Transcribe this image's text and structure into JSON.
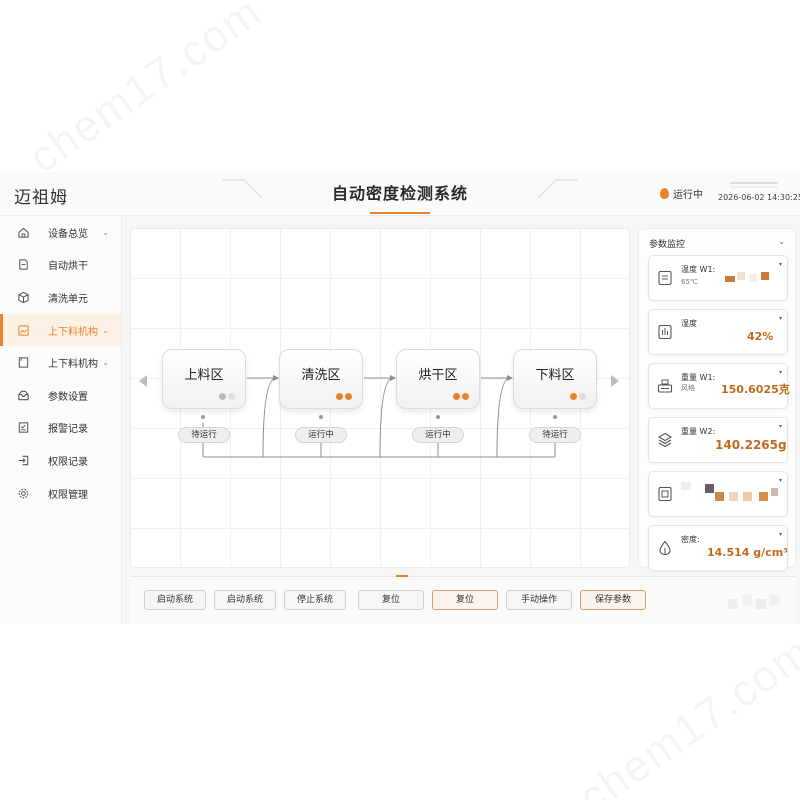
{
  "header": {
    "brand": "迈祖姆",
    "title": "自动密度检测系统",
    "status": "运行中",
    "datetime": "2026-06-02  14:30:25"
  },
  "sidebar": {
    "items": [
      {
        "label": "设备总览",
        "icon": "home-icon",
        "chevron": true,
        "active": false
      },
      {
        "label": "自动烘干",
        "icon": "document-icon",
        "chevron": false,
        "active": false
      },
      {
        "label": "清洗单元",
        "icon": "cube-icon",
        "chevron": false,
        "active": false
      },
      {
        "label": "上下料机构",
        "icon": "image-icon",
        "chevron": true,
        "active": true
      },
      {
        "label": "上下料机构",
        "icon": "document-icon",
        "chevron": true,
        "active": false
      },
      {
        "label": "参数设置",
        "icon": "inbox-icon",
        "chevron": false,
        "active": false
      },
      {
        "label": "报警记录",
        "icon": "checklist-icon",
        "chevron": false,
        "active": false
      },
      {
        "label": "权限记录",
        "icon": "login-icon",
        "chevron": false,
        "active": false
      },
      {
        "label": "权限管理",
        "icon": "gear-icon",
        "chevron": false,
        "active": false
      }
    ]
  },
  "flow": {
    "stages": [
      {
        "label": "上料区",
        "status": "待运行",
        "indicator": "idle"
      },
      {
        "label": "清洗区",
        "status": "运行中",
        "indicator": "running"
      },
      {
        "label": "烘干区",
        "status": "运行中",
        "indicator": "running"
      },
      {
        "label": "下料区",
        "status": "待运行",
        "indicator": "idle"
      }
    ]
  },
  "monitor": {
    "title": "参数监控",
    "cards": [
      {
        "label": "温度 W1:",
        "sub": "65℃",
        "value": "",
        "icon": "thermometer-icon"
      },
      {
        "label": "湿度",
        "sub": "",
        "value": "42%",
        "icon": "chart-icon"
      },
      {
        "label": "重量 W1:",
        "sub": "风格",
        "value": "150.6025克",
        "icon": "scale-icon"
      },
      {
        "label": "重量 W2:",
        "sub": "",
        "value": "140.2265g",
        "icon": "layers-icon"
      },
      {
        "label": "",
        "sub": "",
        "value": "",
        "icon": "device-icon"
      },
      {
        "label": "密度:",
        "sub": "",
        "value": "14.514 g/cm³",
        "icon": "drop-icon"
      }
    ]
  },
  "controls": {
    "buttons": [
      {
        "label": "启动系统",
        "accent": false
      },
      {
        "label": "启动系统",
        "accent": false
      },
      {
        "label": "停止系统",
        "accent": false
      },
      {
        "label": "复位",
        "accent": false
      },
      {
        "label": "复位",
        "accent": true
      },
      {
        "label": "手动操作",
        "accent": false
      },
      {
        "label": "保存参数",
        "accent": true
      }
    ]
  },
  "colors": {
    "accent": "#e8832a",
    "value": "#c06a1e"
  }
}
